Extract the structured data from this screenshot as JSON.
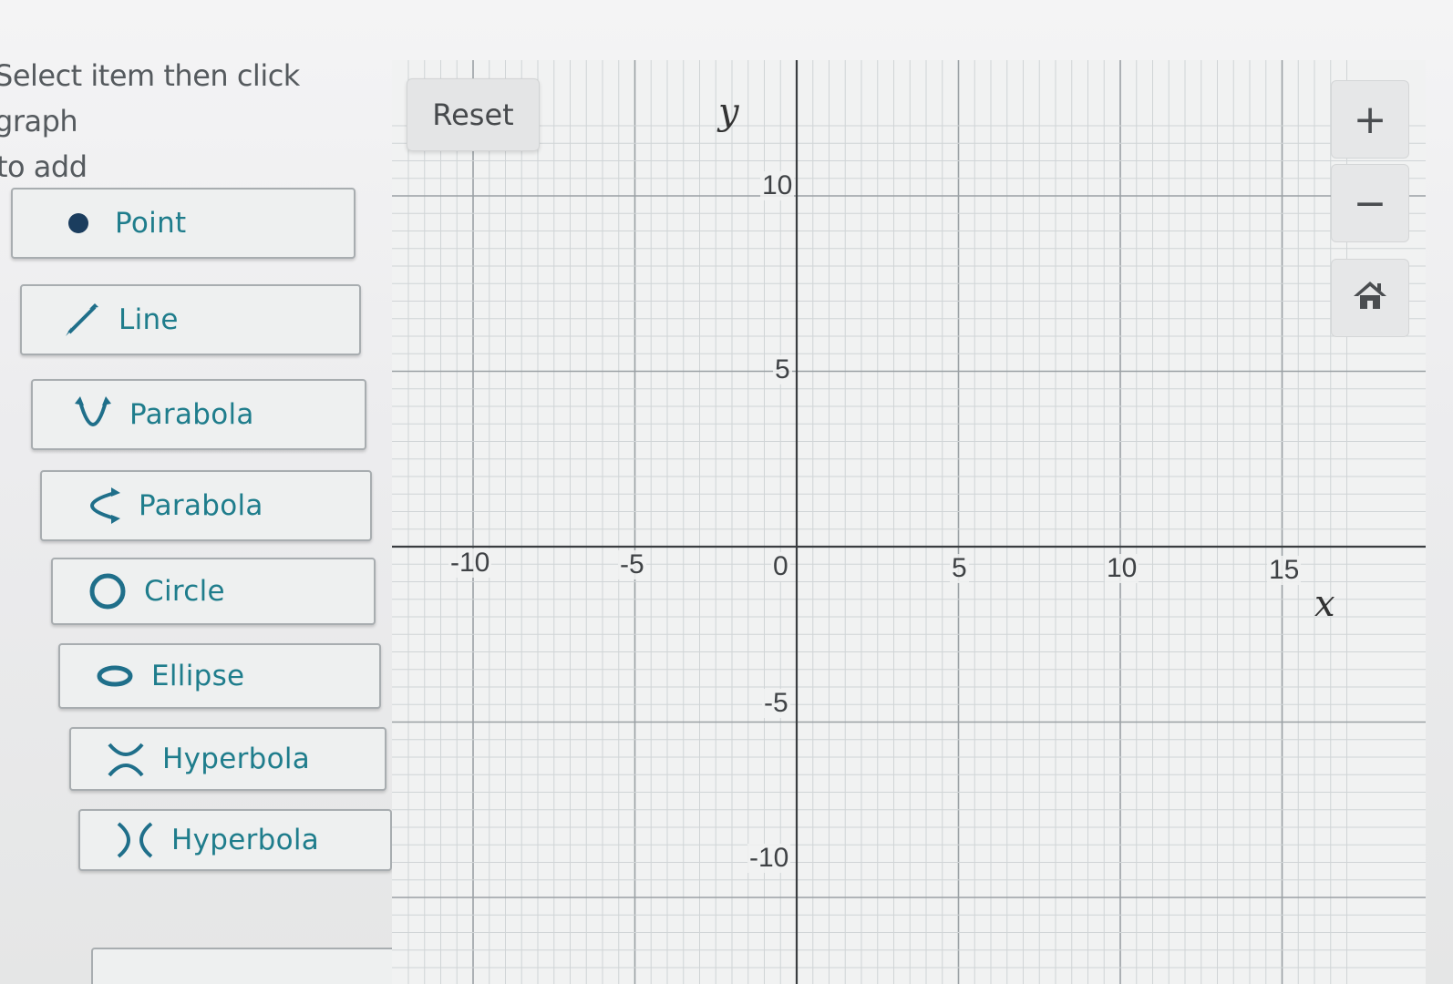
{
  "instruction": {
    "line1": "Select item then click graph",
    "line2": "to add"
  },
  "tools": [
    {
      "label": "Point",
      "icon": "point-icon"
    },
    {
      "label": "Line",
      "icon": "line-icon"
    },
    {
      "label": "Parabola",
      "icon": "vertical-parabola-icon"
    },
    {
      "label": "Parabola",
      "icon": "horizontal-parabola-icon"
    },
    {
      "label": "Circle",
      "icon": "circle-icon"
    },
    {
      "label": "Ellipse",
      "icon": "ellipse-icon"
    },
    {
      "label": "Hyperbola",
      "icon": "vertical-hyperbola-icon"
    },
    {
      "label": "Hyperbola",
      "icon": "horizontal-hyperbola-icon"
    }
  ],
  "graph": {
    "reset_label": "Reset",
    "zoom_in_label": "+",
    "zoom_out_label": "−",
    "home_icon": "home-icon",
    "x_axis_name": "x",
    "y_axis_name": "y",
    "x_ticks": [
      "-10",
      "-5",
      "0",
      "5",
      "10",
      "15"
    ],
    "y_ticks": [
      "10",
      "5",
      "-5",
      "-10"
    ],
    "x_range": [
      -12,
      17
    ],
    "y_range": [
      -13,
      12
    ],
    "accent_color": "#1f7d8c"
  }
}
